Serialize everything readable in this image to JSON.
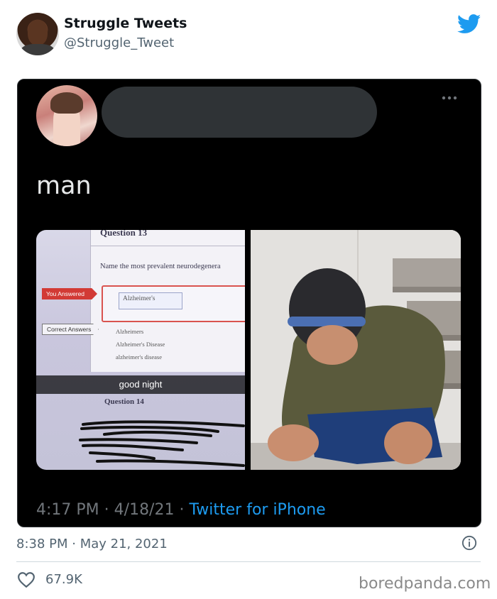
{
  "author": {
    "display_name": "Struggle Tweets",
    "handle": "@Struggle_Tweet"
  },
  "embedded_tweet": {
    "text": "man",
    "time": "4:17 PM",
    "separator": "·",
    "date": "4/18/21",
    "source": "Twitter for iPhone",
    "media_left": {
      "question_header": "Question 13",
      "question_text": "Name the most prevalent neurodegenera",
      "you_answered_label": "You Answered",
      "answer_value": "Alzheimer's",
      "correct_answers_label": "Correct Answers",
      "correct_answers": [
        "Alzheimers",
        "Alzheimer's Disease",
        "alzheimer's disease"
      ],
      "caption": "good night",
      "next_question_header": "Question 14"
    }
  },
  "footer": {
    "timestamp": "8:38 PM · May 21, 2021",
    "like_count": "67.9K",
    "watermark": "boredpanda.com"
  },
  "colors": {
    "twitter_blue": "#1d9bf0",
    "dark_bg": "#000000",
    "secondary_text": "#536471",
    "error_red": "#d23a35"
  }
}
